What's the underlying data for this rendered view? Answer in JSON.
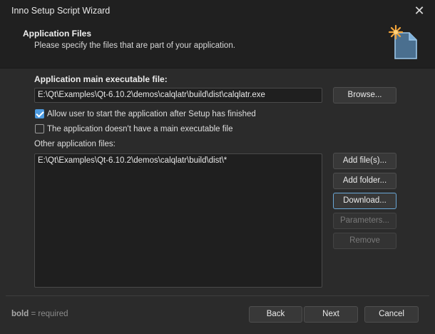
{
  "window": {
    "title": "Inno Setup Script Wizard"
  },
  "header": {
    "title": "Application Files",
    "subtitle": "Please specify the files that are part of your application."
  },
  "main": {
    "exe_label": "Application main executable file:",
    "exe_value": "E:\\Qt\\Examples\\Qt-6.10.2\\demos\\calqlatr\\build\\dist\\calqlatr.exe",
    "browse_label": "Browse...",
    "allow_start_label": "Allow user to start the application after Setup has finished",
    "allow_start_checked": true,
    "no_main_exe_label": "The application doesn't have a main executable file",
    "no_main_exe_checked": false,
    "other_files_label": "Other application files:",
    "other_files": [
      "E:\\Qt\\Examples\\Qt-6.10.2\\demos\\calqlatr\\build\\dist\\*"
    ],
    "buttons": {
      "add_files": "Add file(s)...",
      "add_folder": "Add folder...",
      "download": "Download...",
      "parameters": "Parameters...",
      "remove": "Remove"
    }
  },
  "footer": {
    "bold_word": "bold",
    "required_text": " = required",
    "back": "Back",
    "next": "Next",
    "cancel": "Cancel"
  },
  "colors": {
    "accent": "#4c9ae0",
    "focus_border": "#6aa7d6",
    "background": "#2b2b2b",
    "header_bg": "#202020"
  }
}
